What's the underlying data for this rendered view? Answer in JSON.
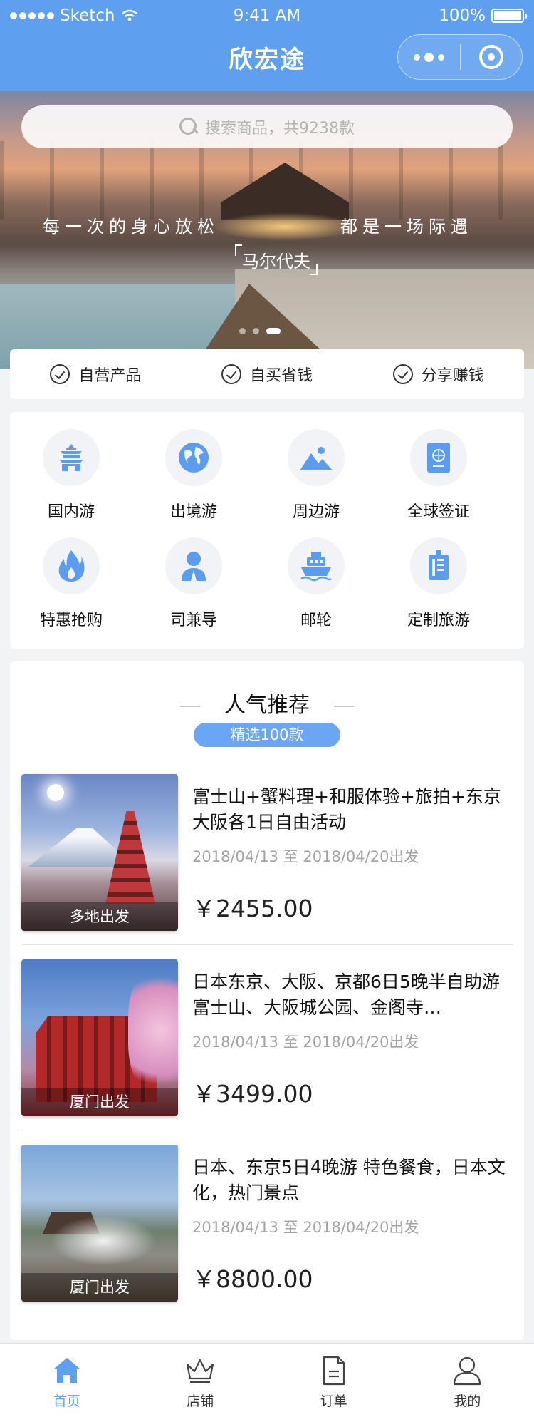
{
  "status_bar": {
    "carrier": "Sketch",
    "time": "9:41 AM",
    "battery": "100%"
  },
  "nav": {
    "title": "欣宏途",
    "more_icon": "more-dots-icon",
    "close_icon": "miniprogram-close-icon"
  },
  "banner": {
    "search_placeholder": "搜索商品，共9238款",
    "slogan_left": "每一次的身心放松",
    "slogan_right": "都是一场际遇",
    "place": "马尔代夫",
    "carousel_count": 3,
    "carousel_active": 3
  },
  "features": [
    {
      "label": "自营产品",
      "icon": "check-circle-icon"
    },
    {
      "label": "自买省钱",
      "icon": "check-circle-icon"
    },
    {
      "label": "分享赚钱",
      "icon": "check-circle-icon"
    }
  ],
  "categories": [
    {
      "label": "国内游",
      "icon": "temple-icon"
    },
    {
      "label": "出境游",
      "icon": "globe-icon"
    },
    {
      "label": "周边游",
      "icon": "landscape-icon"
    },
    {
      "label": "全球签证",
      "icon": "passport-icon"
    },
    {
      "label": "特惠抢购",
      "icon": "flame-icon"
    },
    {
      "label": "司兼导",
      "icon": "guide-person-icon"
    },
    {
      "label": "邮轮",
      "icon": "cruise-ship-icon"
    },
    {
      "label": "定制旅游",
      "icon": "custom-luggage-icon"
    }
  ],
  "recommend": {
    "title": "人气推荐",
    "badge": "精选100款",
    "items": [
      {
        "name": "富士山+蟹料理+和服体验+旅拍+东京大阪各1日自由活动",
        "date": "2018/04/13 至 2018/04/20出发",
        "price": "￥2455.00",
        "depart": "多地出发"
      },
      {
        "name": "日本东京、大阪、京都6日5晚半自助游　富士山、大阪城公园、金阁寺…",
        "date": "2018/04/13 至 2018/04/20出发",
        "price": "￥3499.00",
        "depart": "厦门出发"
      },
      {
        "name": "日本、东京5日4晚游 特色餐食，日本文化，热门景点",
        "date": "2018/04/13 至 2018/04/20出发",
        "price": "￥8800.00",
        "depart": "厦门出发"
      }
    ]
  },
  "tabbar": [
    {
      "label": "首页",
      "icon": "home-icon",
      "active": true
    },
    {
      "label": "店铺",
      "icon": "crown-store-icon",
      "active": false
    },
    {
      "label": "订单",
      "icon": "order-document-icon",
      "active": false
    },
    {
      "label": "我的",
      "icon": "user-icon",
      "active": false
    }
  ],
  "colors": {
    "primary": "#5e9ff0",
    "badge": "#6aa6f5",
    "icon_blue": "#5a9cf0",
    "price": "#222222",
    "muted": "#a3a3a3"
  }
}
